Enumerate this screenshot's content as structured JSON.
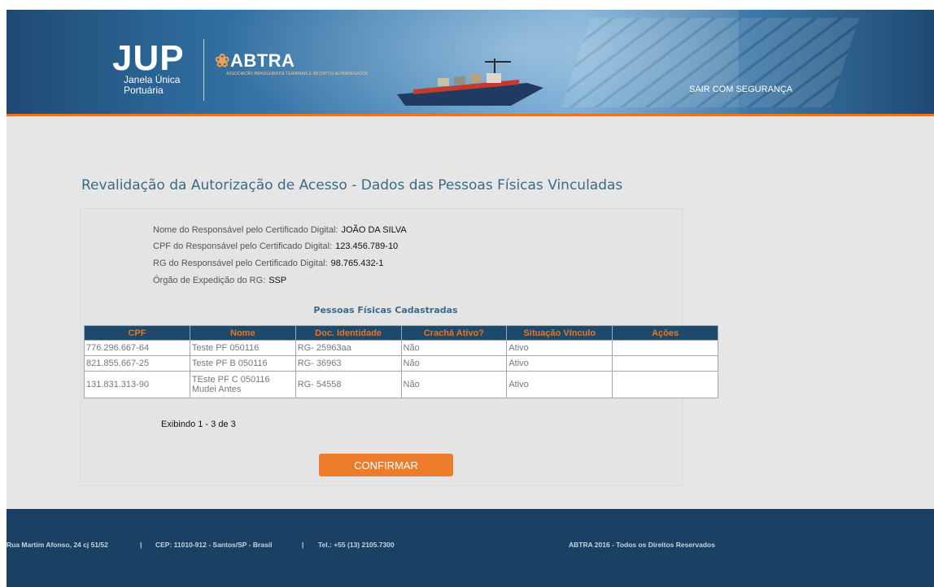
{
  "header": {
    "logo_jup": "JUP",
    "logo_jup_line1": "Janela Única",
    "logo_jup_line2": "Portuária",
    "logo_abtra": "ABTRA",
    "logo_abtra_sub": "ASSOCIAÇÃO BRASILEIRA DE TERMINAIS E RECINTOS ALFANDEGADOS",
    "logout": "SAIR COM SEGURANÇA"
  },
  "page_title": "Revalidação da Autorização de Acesso - Dados das Pessoas Físicas Vinculadas",
  "responsible": {
    "name_label": "Nome do Responsável pelo Certificado Digital:",
    "name_value": "JOÃO DA SILVA",
    "cpf_label": "CPF do Responsável pelo Certificado Digital:",
    "cpf_value": "123.456.789-10",
    "rg_label": "RG do Responsável pelo Certificado Digital:",
    "rg_value": "98.765.432-1",
    "org_label": "Órgão de Expedição do RG:",
    "org_value": "SSP"
  },
  "table": {
    "title": "Pessoas Físicas Cadastradas",
    "columns": [
      "CPF",
      "Nome",
      "Doc. Identidade",
      "Crachá Ativo?",
      "Situação Vínculo",
      "Ações"
    ],
    "rows": [
      [
        "776.296.667-64",
        "Teste PF 050116",
        "RG- 25963aa",
        "Não",
        "Ativo",
        ""
      ],
      [
        "821.855.667-25",
        "Teste PF B 050116",
        "RG- 36963",
        "Não",
        "Ativo",
        ""
      ],
      [
        "131.831.313-90",
        "TEste PF C 050116 Mudei Antes",
        "RG- 54558",
        "Não",
        "Ativo",
        ""
      ]
    ]
  },
  "pagination": "Exibindo 1 - 3 de 3",
  "confirm_label": "CONFIRMAR",
  "footer": {
    "address": "Rua Martim Afonso, 24 cj 51/52",
    "cep": "CEP: 11010-912 - Santos/SP - Brasil",
    "phone": "Tel.: +55 (13) 2105.7300",
    "copyright": "ABTRA 2016 - Todos os Direitos Reservados",
    "separator": "|"
  },
  "colors": {
    "accent": "#ee7d2b",
    "navy": "#1a4163",
    "title": "#3b6a87"
  }
}
